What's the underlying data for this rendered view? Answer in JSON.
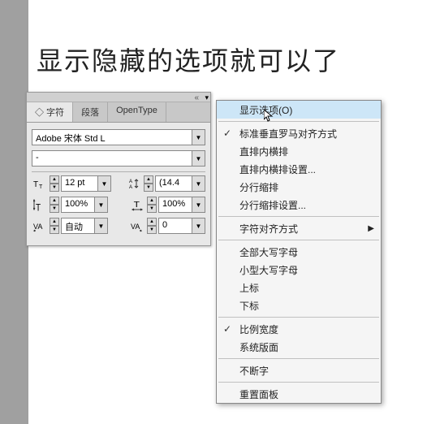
{
  "heading": "显示隐藏的选项就可以了",
  "panel": {
    "tabs": [
      "◇ 字符",
      "段落",
      "OpenType"
    ],
    "font_family": "Adobe 宋体 Std L",
    "font_style": "-",
    "font_size": "12 pt",
    "leading": "(14.4",
    "horiz_scale": "100%",
    "vert_scale": "100%",
    "tracking": "自动",
    "baseline": "0"
  },
  "menu": {
    "items": [
      {
        "label": "显示选项(O)",
        "hover": true
      },
      {
        "sep": true
      },
      {
        "label": "标准垂直罗马对齐方式",
        "checked": true
      },
      {
        "label": "直排内横排"
      },
      {
        "label": "直排内横排设置..."
      },
      {
        "label": "分行缩排"
      },
      {
        "label": "分行缩排设置..."
      },
      {
        "sep": true
      },
      {
        "label": "字符对齐方式",
        "submenu": true
      },
      {
        "sep": true
      },
      {
        "label": "全部大写字母"
      },
      {
        "label": "小型大写字母"
      },
      {
        "label": "上标"
      },
      {
        "label": "下标"
      },
      {
        "sep": true
      },
      {
        "label": "比例宽度",
        "checked": true
      },
      {
        "label": "系统版面"
      },
      {
        "sep": true
      },
      {
        "label": "不断字"
      },
      {
        "sep": true
      },
      {
        "label": "重置面板"
      }
    ]
  }
}
